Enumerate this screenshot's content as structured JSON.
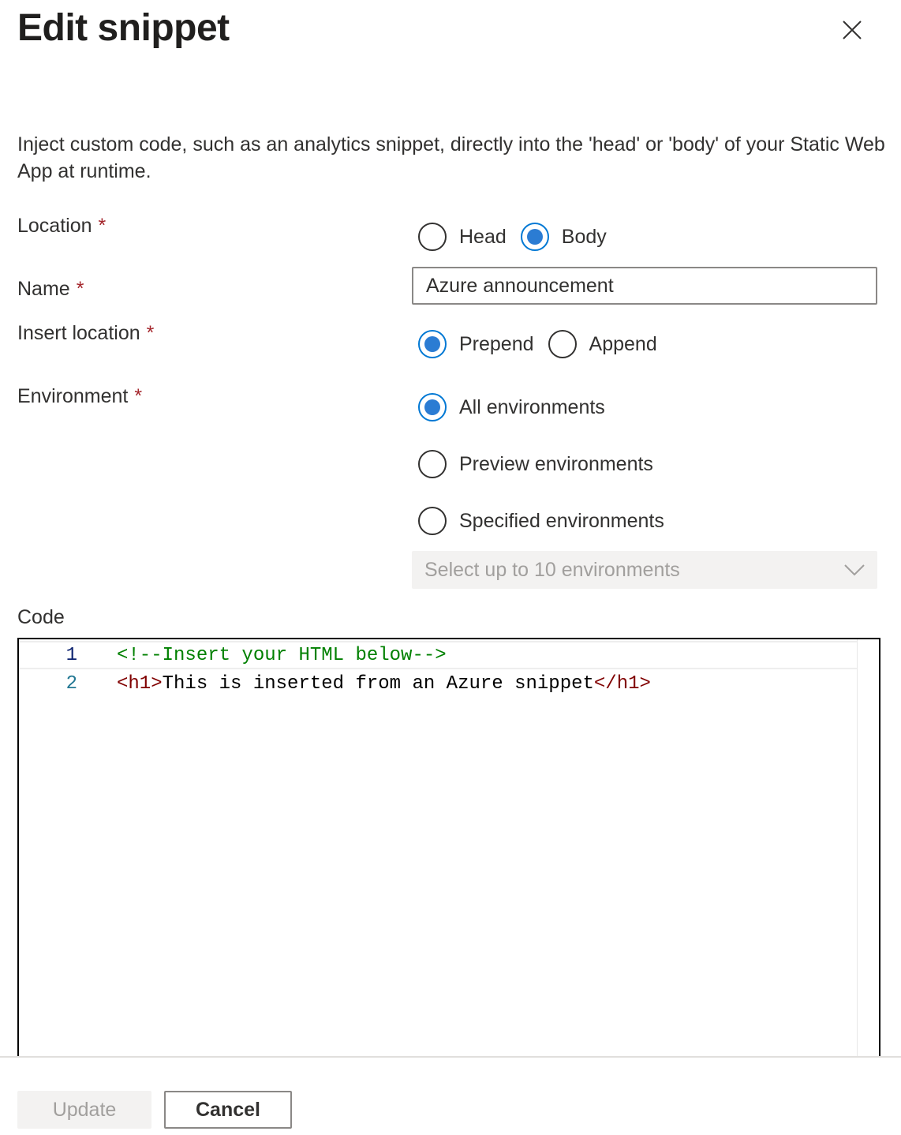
{
  "panel": {
    "title": "Edit snippet",
    "description": "Inject custom code, such as an analytics snippet, directly into the 'head' or 'body' of your Static Web App at runtime."
  },
  "form": {
    "required_marker": "*",
    "location": {
      "label": "Location",
      "options": [
        {
          "label": "Head",
          "checked": false
        },
        {
          "label": "Body",
          "checked": true
        }
      ]
    },
    "name": {
      "label": "Name",
      "value": "Azure announcement"
    },
    "insert_location": {
      "label": "Insert location",
      "options": [
        {
          "label": "Prepend",
          "checked": true
        },
        {
          "label": "Append",
          "checked": false
        }
      ]
    },
    "environment": {
      "label": "Environment",
      "options": [
        {
          "label": "All environments",
          "checked": true
        },
        {
          "label": "Preview environments",
          "checked": false
        },
        {
          "label": "Specified environments",
          "checked": false
        }
      ],
      "select_placeholder": "Select up to 10 environments"
    },
    "code": {
      "label": "Code",
      "lines": [
        {
          "number": "1",
          "comment": "<!--Insert your HTML below-->"
        },
        {
          "number": "2",
          "open_tag": "<h1>",
          "text": "This is inserted from an Azure snippet",
          "close_tag": "</h1>"
        }
      ]
    }
  },
  "footer": {
    "update_label": "Update",
    "cancel_label": "Cancel"
  },
  "colors": {
    "accent": "#0078d4",
    "required": "#a4262c",
    "comment": "#008000",
    "tag": "#800000",
    "line_number": "#237893"
  }
}
